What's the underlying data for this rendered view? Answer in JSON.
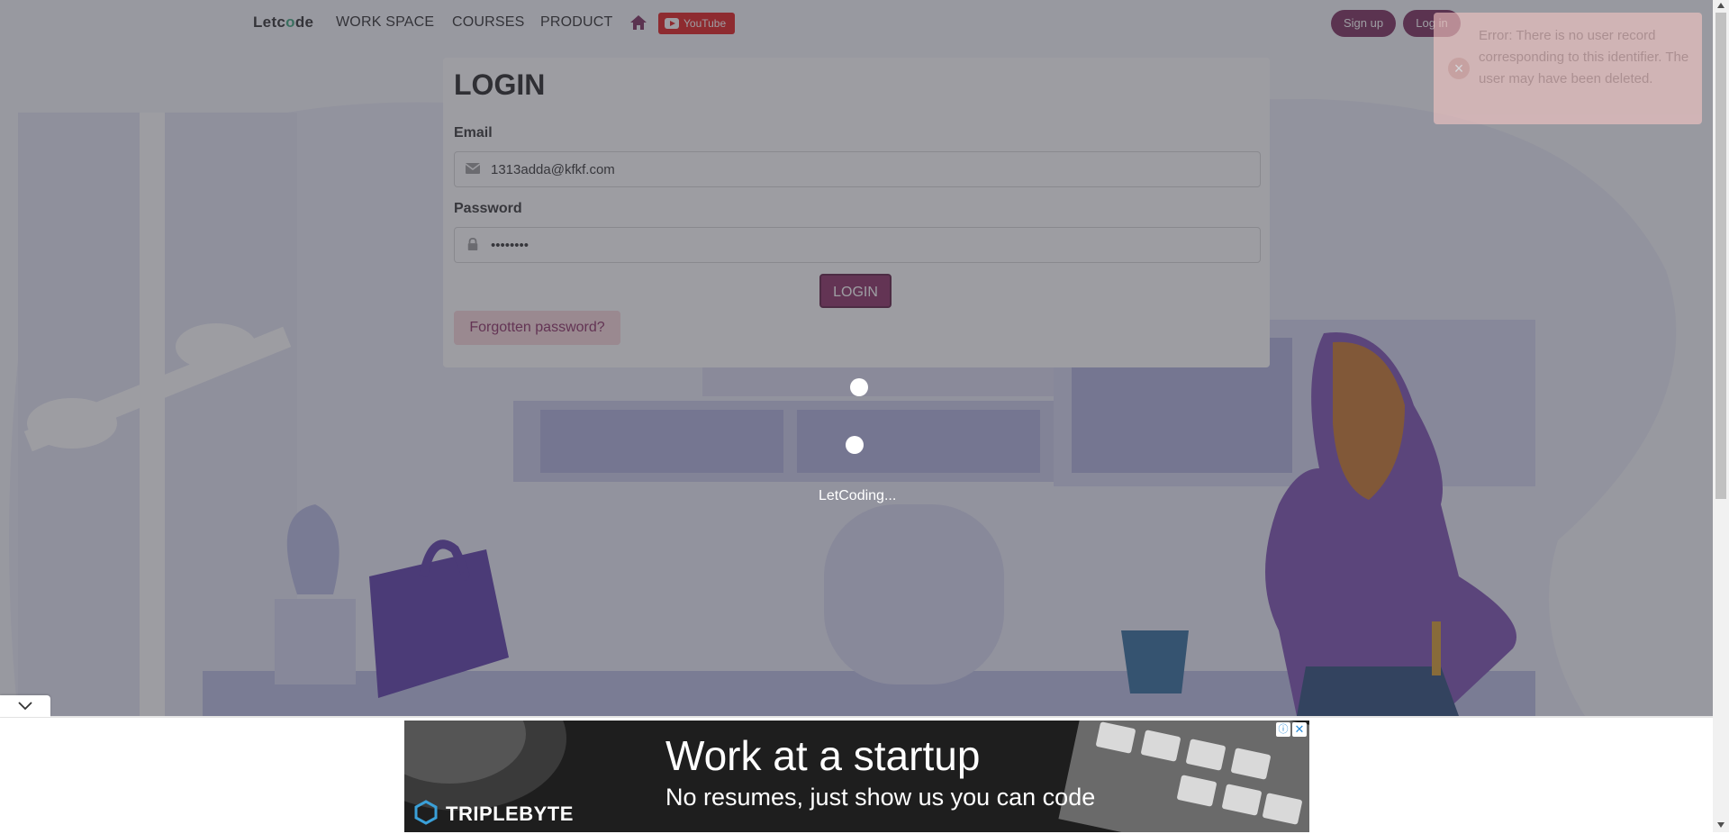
{
  "navbar": {
    "logo": "Letcode",
    "links": [
      "WORK SPACE",
      "COURSES",
      "PRODUCT"
    ],
    "home_icon": "home-icon",
    "youtube_label": "YouTube",
    "signup_label": "Sign up",
    "login_label": "Log in"
  },
  "login_form": {
    "title": "LOGIN",
    "email_label": "Email",
    "email_value": "1313adda@kfkf.com",
    "password_label": "Password",
    "password_value": "••••••••",
    "submit_label": "LOGIN",
    "forgot_label": "Forgotten password?"
  },
  "toast": {
    "message": "Error: There is no user record corresponding to this identifier. The user may have been deleted."
  },
  "loader": {
    "text": "LetCoding..."
  },
  "ad": {
    "headline": "Work at a startup",
    "subline": "No resumes, just show us you can code",
    "brand": "TRIPLEBYTE"
  },
  "colors": {
    "brand": "#8a2c62",
    "error_toast": "#f6c7c4",
    "youtube": "#e01b1b"
  }
}
